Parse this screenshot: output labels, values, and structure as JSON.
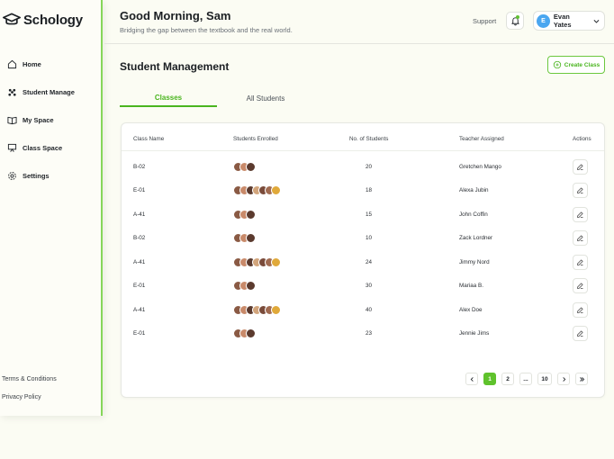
{
  "app": {
    "name": "Schology"
  },
  "sidebar": {
    "items": [
      {
        "label": "Home",
        "icon": "home-icon"
      },
      {
        "label": "Student Manage",
        "icon": "students-icon"
      },
      {
        "label": "My Space",
        "icon": "book-icon"
      },
      {
        "label": "Class Space",
        "icon": "presentation-icon"
      },
      {
        "label": "Settings",
        "icon": "gear-icon"
      }
    ],
    "footer": {
      "terms": "Terms & Conditions",
      "privacy": "Privacy Policy"
    }
  },
  "header": {
    "greeting": "Good Morning, Sam",
    "subtitle": "Bridging the gap between the textbook and the real world.",
    "support": "Support",
    "user": {
      "initial": "E",
      "name": "Evan Yates"
    }
  },
  "main": {
    "title": "Student Management",
    "create_label": "Create Class",
    "tabs": [
      {
        "label": "Classes"
      },
      {
        "label": "All Students"
      }
    ],
    "table": {
      "headers": {
        "class_name": "Class Name",
        "enrolled": "Students Enrolled",
        "count": "No. of Students",
        "teacher": "Teacher Assigned",
        "actions": "Actions"
      },
      "rows": [
        {
          "class_name": "B-02",
          "count": "20",
          "teacher": "Gretchen Mango",
          "avatars": 3
        },
        {
          "class_name": "E-01",
          "count": "18",
          "teacher": "Alexa Jubin",
          "avatars": 7
        },
        {
          "class_name": "A-41",
          "count": "15",
          "teacher": "John Coffin",
          "avatars": 3
        },
        {
          "class_name": "B-02",
          "count": "10",
          "teacher": "Zack Lordner",
          "avatars": 3
        },
        {
          "class_name": "A-41",
          "count": "24",
          "teacher": "Jimmy Nord",
          "avatars": 7
        },
        {
          "class_name": "E-01",
          "count": "30",
          "teacher": "Mariaa B.",
          "avatars": 3
        },
        {
          "class_name": "A-41",
          "count": "40",
          "teacher": "Alex Doe",
          "avatars": 7
        },
        {
          "class_name": "E-01",
          "count": "23",
          "teacher": "Jennie Jims",
          "avatars": 3
        }
      ]
    },
    "pagination": {
      "pages": [
        "1",
        "2",
        "...",
        "10"
      ],
      "current": "1"
    }
  },
  "colors": {
    "accent": "#4ab51f",
    "sidebar_border": "#86d65a",
    "avatar": "#4aa6f0"
  }
}
